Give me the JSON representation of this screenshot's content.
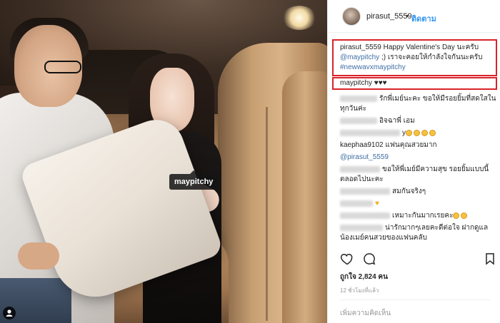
{
  "photo": {
    "tag_label": "maypitchy",
    "user_tag_icon": "person-icon"
  },
  "header": {
    "username": "pirasut_5559",
    "separator": "•",
    "follow_label": "ติดตาม"
  },
  "caption": {
    "username": "pirasut_5559",
    "text": "Happy Valentine's Day นะครับ",
    "mention": "@maypitchy",
    "text2": ";) เราจะคอยให้กำลังใจกันนะครับ",
    "hashtag": "#newwavxmaypitchy"
  },
  "highlighted_reply": {
    "username": "maypitchy",
    "hearts": "♥♥♥"
  },
  "comments": [
    {
      "blur_width": 52,
      "text": "รักพี่เมย์นะคะ ขอให้มีรอยยิ้มที่สดใสในทุกวันค่ะ"
    },
    {
      "blur_width": 52,
      "text": "อิจฉาพี่ เอม"
    },
    {
      "blur_width": 84,
      "text": "y",
      "emojis": 4
    },
    {
      "blur_width": 0,
      "text": "kaephaa9102 แฟนคุณสวยมาก"
    },
    {
      "blur_width": 0,
      "text": "@pirasut_5559",
      "is_mention": true
    },
    {
      "blur_width": 56,
      "text": "ขอให้พี่เมย์มีความสุข รอยยิ้มแบบนี้ตลอดไปนะคะ"
    },
    {
      "blur_width": 70,
      "text": "สมกันจริงๆ"
    },
    {
      "blur_width": 46,
      "text": "",
      "heart": "♥"
    },
    {
      "blur_width": 70,
      "text": "เหมาะกันมากเรยคะ",
      "emojis": 2
    },
    {
      "blur_width": 60,
      "text": "น่ารักมากๆเลยคะดีต่อใจ ฝากดูแลน้องเมย์คนสวยของแฟนคลับ"
    }
  ],
  "actions": {
    "like_icon": "heart-icon",
    "comment_icon": "comment-icon",
    "save_icon": "bookmark-icon"
  },
  "likes_text": "ถูกใจ 2,824 คน",
  "time_text": "12 ชั่วโมงที่แล้ว",
  "add_comment_placeholder": "เพิ่มความคิดเห็น"
}
